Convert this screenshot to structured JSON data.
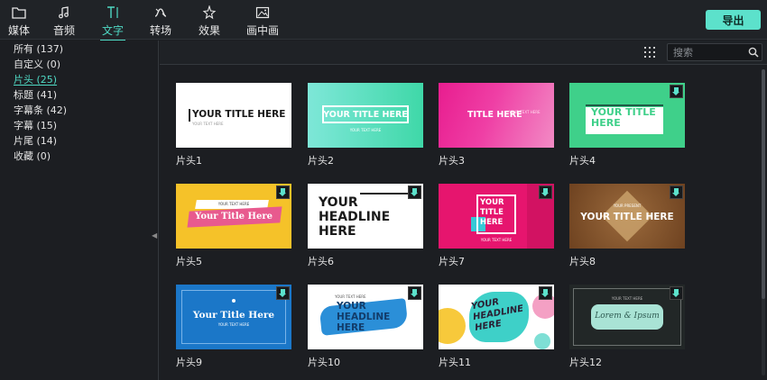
{
  "toolbar": {
    "tools": [
      {
        "label": "媒体",
        "icon": "folder-icon"
      },
      {
        "label": "音频",
        "icon": "music-note-icon"
      },
      {
        "label": "文字",
        "icon": "text-icon"
      },
      {
        "label": "转场",
        "icon": "transition-icon"
      },
      {
        "label": "效果",
        "icon": "effects-icon"
      },
      {
        "label": "画中画",
        "icon": "picture-in-picture-icon"
      }
    ],
    "active": "文字",
    "export_label": "导出",
    "accent_color": "#5ce1cb"
  },
  "sidebar": {
    "categories": [
      {
        "label": "所有 (137)"
      },
      {
        "label": "自定义 (0)"
      },
      {
        "label": "片头 (25)",
        "active": true
      },
      {
        "label": "标题 (41)"
      },
      {
        "label": "字幕条 (42)"
      },
      {
        "label": "字幕 (15)"
      },
      {
        "label": "片尾 (14)"
      },
      {
        "label": "收藏 (0)"
      }
    ]
  },
  "search": {
    "placeholder": "搜索"
  },
  "grid": {
    "items": [
      {
        "label": "片头1",
        "title_text": "YOUR TITLE HERE",
        "sub_text": "YOUR TEXT HERE",
        "download": false
      },
      {
        "label": "片头2",
        "title_text": "YOUR TITLE HERE",
        "sub_text": "YOUR TEXT HERE",
        "download": false
      },
      {
        "label": "片头3",
        "title_text": "TITLE HERE",
        "sub_text": "YOUR TEXT HERE",
        "download": false
      },
      {
        "label": "片头4",
        "title_text": "YOUR TITLE HERE",
        "download": true
      },
      {
        "label": "片头5",
        "title_text": "Your Title Here",
        "sub_text": "YOUR TEXT HERE",
        "download": true
      },
      {
        "label": "片头6",
        "title_text": "YOUR HEADLINE HERE",
        "download": true
      },
      {
        "label": "片头7",
        "title_text": "YOUR TITLE HERE",
        "sub_text": "YOUR TEXT HERE",
        "download": true
      },
      {
        "label": "片头8",
        "title_text": "YOUR TITLE HERE",
        "sub_text": "YOUR PRESENT",
        "download": true
      },
      {
        "label": "片头9",
        "title_text": "Your Title Here",
        "sub_text": "YOUR TEXT HERE",
        "download": true
      },
      {
        "label": "片头10",
        "title_text": "YOUR HEADLINE HERE",
        "sub_text": "YOUR TEXT HERE",
        "download": true
      },
      {
        "label": "片头11",
        "title_text": "YOUR HEADLINE HERE",
        "download": true
      },
      {
        "label": "片头12",
        "title_text": "Lorem & Ipsum",
        "sub_text": "YOUR TEXT HERE",
        "download": true
      }
    ]
  }
}
